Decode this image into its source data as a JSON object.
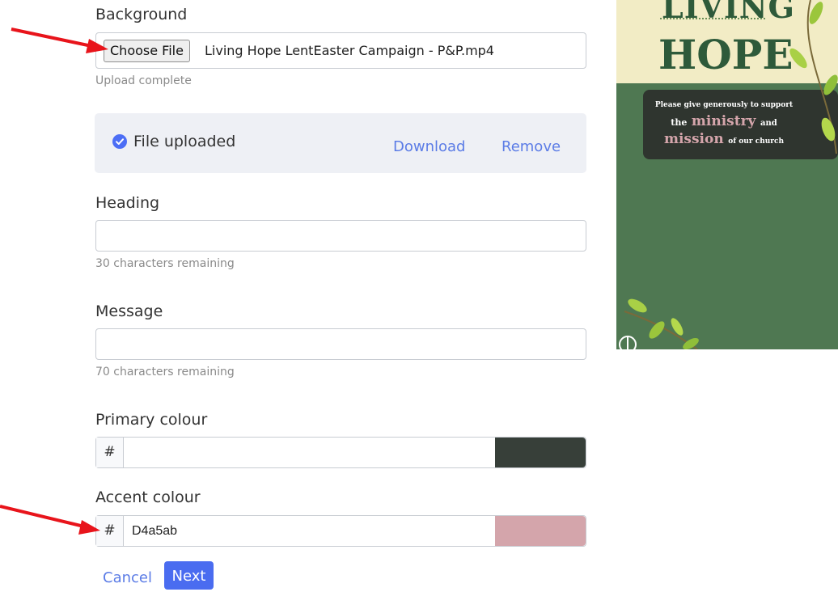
{
  "background": {
    "label": "Background",
    "choose_file_label": "Choose File",
    "file_name": "Living Hope LentEaster Campaign - P&P.mp4",
    "status": "Upload complete"
  },
  "upload_panel": {
    "status_label": "File uploaded",
    "download_label": "Download",
    "remove_label": "Remove"
  },
  "heading": {
    "label": "Heading",
    "value": "",
    "remaining": "30 characters remaining"
  },
  "message": {
    "label": "Message",
    "value": "",
    "remaining": "70 characters remaining"
  },
  "primary_colour": {
    "label": "Primary colour",
    "prefix": "#",
    "value": "",
    "swatch": "#373f39"
  },
  "accent_colour": {
    "label": "Accent colour",
    "prefix": "#",
    "value": "D4a5ab",
    "swatch": "#d4a5ab"
  },
  "actions": {
    "cancel_label": "Cancel",
    "next_label": "Next"
  },
  "preview": {
    "title_line1": "LIVING",
    "title_line2": "HOPE",
    "text_line1": "Please give generously to support",
    "text_the": "the",
    "text_ministry": "ministry",
    "text_and": "and",
    "text_mission": "mission",
    "text_tail": "of our church",
    "bg_color": "#4f7852",
    "top_color": "#f2ecc5",
    "box_color": "#2f352f",
    "accent_text_color": "#d4a5ab"
  }
}
